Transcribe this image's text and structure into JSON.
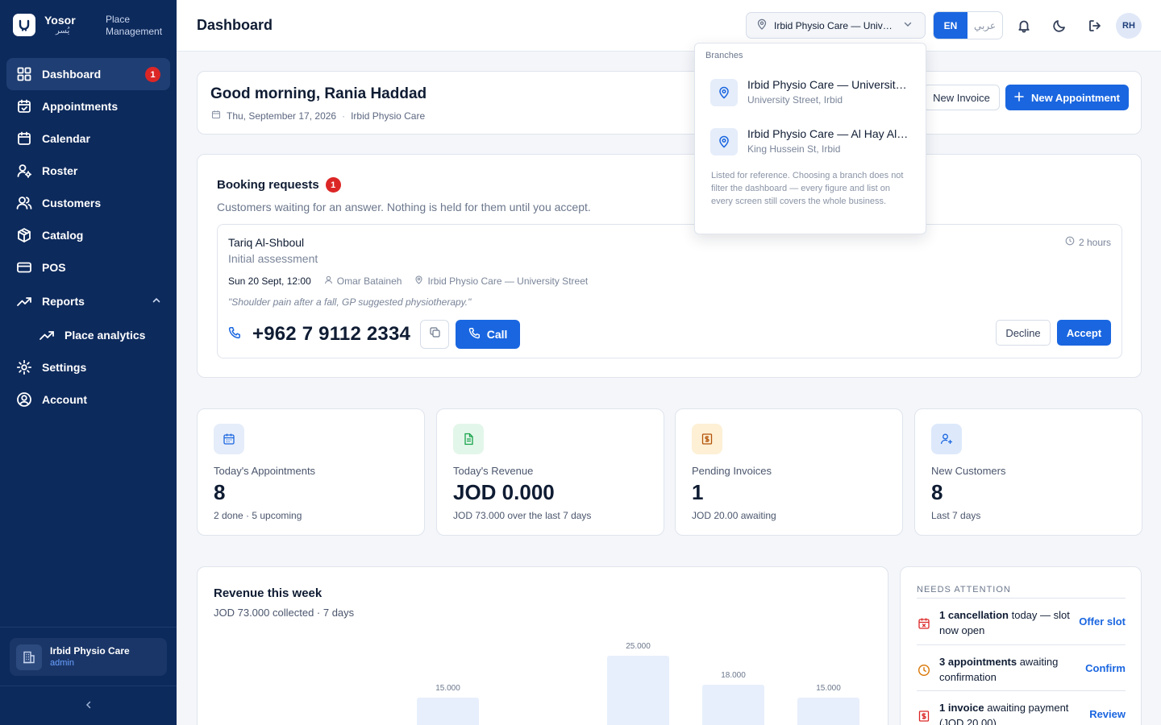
{
  "brand": {
    "name": "Yosor",
    "name_ar": "يُسر",
    "subtitle_line1": "Place",
    "subtitle_line2": "Management"
  },
  "sidebar": {
    "items": [
      {
        "label": "Dashboard",
        "badge": "1"
      },
      {
        "label": "Appointments"
      },
      {
        "label": "Calendar"
      },
      {
        "label": "Roster"
      },
      {
        "label": "Customers"
      },
      {
        "label": "Catalog"
      },
      {
        "label": "POS"
      },
      {
        "label": "Reports"
      },
      {
        "label": "Place analytics"
      },
      {
        "label": "Settings"
      },
      {
        "label": "Account"
      }
    ],
    "place": {
      "name": "Irbid Physio Care",
      "role": "admin"
    }
  },
  "topbar": {
    "title": "Dashboard",
    "branch": "Irbid Physio Care — University Street",
    "lang_en": "EN",
    "lang_ar": "عربي",
    "avatar": "RH"
  },
  "dropdown": {
    "heading": "Branches",
    "branches": [
      {
        "name": "Irbid Physio Care — University Street",
        "address": "University Street, Irbid"
      },
      {
        "name": "Irbid Physio Care — Al Hay Al Janoubi",
        "address": "King Hussein St, Irbid"
      }
    ],
    "note": "Listed for reference. Choosing a branch does not filter the dashboard — every figure and list on every screen still covers the whole business."
  },
  "greeting": {
    "title": "Good morning, Rania Haddad",
    "date": "Thu, September 17, 2026",
    "place": "Irbid Physio Care",
    "new_invoice": "New Invoice",
    "new_appointment": "New Appointment"
  },
  "booking": {
    "title": "Booking requests",
    "count": "1",
    "description": "Customers waiting for an answer. Nothing is held for them until you accept.",
    "request": {
      "customer": "Tariq Al-Shboul",
      "service": "Initial assessment",
      "ago": "2 hours",
      "when": "Sun 20 Sept, 12:00",
      "staff": "Omar Bataineh",
      "branch": "Irbid Physio Care — University Street",
      "note": "\"Shoulder pain after a fall, GP suggested physiotherapy.\"",
      "phone": "+962 7 9112 2334",
      "call": "Call",
      "decline": "Decline",
      "accept": "Accept"
    }
  },
  "stats": [
    {
      "label": "Today's Appointments",
      "value": "8",
      "sub": "2 done · 5 upcoming",
      "icon": "calendar-icon",
      "bg": "#e5edfa",
      "fg": "#1a66e0"
    },
    {
      "label": "Today's Revenue",
      "value": "JOD 0.000",
      "sub": "JOD 73.000 over the last 7 days",
      "icon": "document-icon",
      "bg": "#e3f6ea",
      "fg": "#16a34a"
    },
    {
      "label": "Pending Invoices",
      "value": "1",
      "sub": "JOD 20.00 awaiting",
      "icon": "invoice-icon",
      "bg": "#fdf0d5",
      "fg": "#b45309"
    },
    {
      "label": "New Customers",
      "value": "8",
      "sub": "Last 7 days",
      "icon": "user-plus-icon",
      "bg": "#dde9fb",
      "fg": "#1a66e0"
    }
  ],
  "revenue": {
    "title": "Revenue this week",
    "subtitle": "JOD 73.000 collected · 7 days"
  },
  "chart_data": {
    "type": "bar",
    "categories": [
      "",
      "",
      "",
      "",
      "",
      "",
      ""
    ],
    "values": [
      0,
      15,
      0,
      25,
      18,
      15,
      0
    ],
    "value_labels": [
      "",
      "15.000",
      "",
      "25.000",
      "18.000",
      "15.000",
      ""
    ],
    "title": "Revenue this week",
    "xlabel": "",
    "ylabel": "",
    "ylim": [
      0,
      25
    ],
    "grid": false,
    "color": "#e7effc"
  },
  "attention": {
    "heading": "NEEDS ATTENTION",
    "items": [
      {
        "bold": "1 cancellation",
        "rest": " today — slot now open",
        "action": "Offer slot",
        "color": "#dc2626",
        "icon": "calendar-x-icon"
      },
      {
        "bold": "3 appointments",
        "rest": " awaiting confirmation",
        "action": "Confirm",
        "color": "#d97706",
        "icon": "clock-icon"
      },
      {
        "bold": "1 invoice",
        "rest": " awaiting payment (JOD 20.00)",
        "action": "Review",
        "color": "#dc2626",
        "icon": "invoice-icon"
      }
    ]
  }
}
